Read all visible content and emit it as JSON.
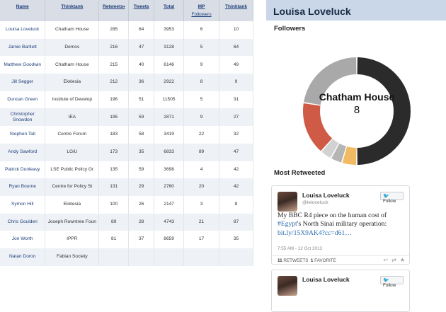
{
  "table": {
    "headers": [
      "Name",
      "Thinktank",
      "Retweets",
      "Tweets",
      "Total",
      "MP",
      "Thinktank"
    ],
    "mp_sub": "Followers",
    "rows": [
      [
        "Louisa Loveluck",
        "Chatham House",
        "285",
        "64",
        "3953",
        "6",
        "10"
      ],
      [
        "Jamie Bartlett",
        "Demos",
        "216",
        "47",
        "3128",
        "5",
        "64"
      ],
      [
        "Matthew Goodwin",
        "Chatham House",
        "215",
        "40",
        "6146",
        "9",
        "49"
      ],
      [
        "Jill Segger",
        "Ekklesia",
        "212",
        "36",
        "2922",
        "8",
        "9"
      ],
      [
        "Duncan Green",
        "Institute of Develop",
        "196",
        "51",
        "11505",
        "5",
        "31"
      ],
      [
        "Christopher Snowdon",
        "IEA",
        "195",
        "59",
        "2871",
        "9",
        "27"
      ],
      [
        "Stephen Tall",
        "Centre Forum",
        "183",
        "58",
        "3419",
        "22",
        "32"
      ],
      [
        "Andy Sawford",
        "LGiU",
        "173",
        "35",
        "6833",
        "89",
        "47"
      ],
      [
        "Patrick Dunleavy",
        "LSE Public Policy Gr",
        "135",
        "59",
        "3698",
        "4",
        "42"
      ],
      [
        "Ryan Bourne",
        "Centre for Policy St",
        "131",
        "29",
        "2760",
        "20",
        "42"
      ],
      [
        "Symon Hill",
        "Ekklesia",
        "100",
        "26",
        "2147",
        "3",
        "8"
      ],
      [
        "Chris Goulden",
        "Joseph Rowntree Foun",
        "89",
        "28",
        "4743",
        "21",
        "87"
      ],
      [
        "Jon Worth",
        "IPPR",
        "81",
        "37",
        "8659",
        "17",
        "35"
      ],
      [
        "Natan Doron",
        "Fabian Society",
        "",
        "",
        "",
        "",
        ""
      ]
    ]
  },
  "panel": {
    "title": "Louisa Loveluck",
    "followers_heading": "Followers",
    "donut_center_name": "Chatham House",
    "donut_center_value": "8",
    "most_retweeted_heading": "Most Retweeted"
  },
  "donut": {
    "segments": [
      {
        "value": 50,
        "color": "#2b2b2b"
      },
      {
        "value": 4.5,
        "color": "#f0bb63"
      },
      {
        "value": 3.5,
        "color": "#b5b5b5"
      },
      {
        "value": 3.5,
        "color": "#d2d2d2"
      },
      {
        "value": 16,
        "color": "#cf5a45"
      },
      {
        "value": 22.5,
        "color": "#a9a9a9"
      }
    ]
  },
  "tweet": {
    "name": "Louisa Loveluck",
    "handle": "@leloveluck",
    "follow_label": "Follow",
    "text_1": "My BBC R4 piece on the human cost of",
    "hashtag": "#Egypt",
    "text_2": "'s North Sinai military operation:",
    "link": "bit.ly/15X9AK4?cc=d61…",
    "date": "7:55 AM - 12 Oct 2013",
    "retweets_count": "11",
    "retweets_label": "RETWEETS",
    "favorites_count": "1",
    "favorites_label": "FAVORITE"
  },
  "tweet2": {
    "name": "Louisa Loveluck",
    "follow_label": "Follow"
  },
  "icons": {
    "reply": "reply-icon",
    "retweet": "retweet-icon",
    "favorite": "star-icon",
    "bird": "twitter-bird-icon"
  }
}
